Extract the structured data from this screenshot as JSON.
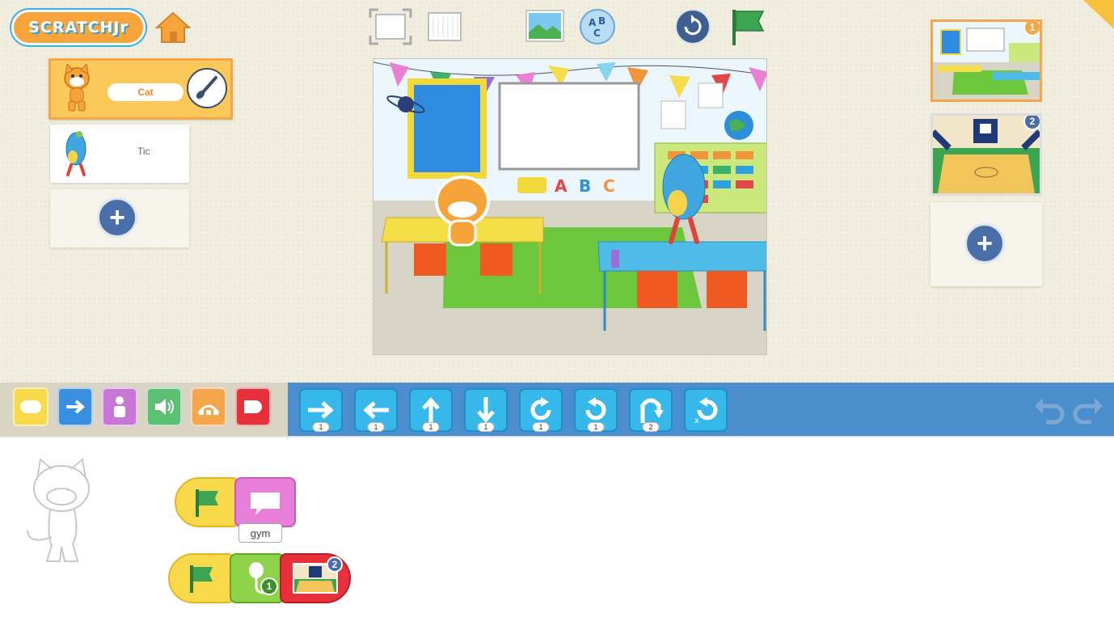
{
  "app": {
    "logo_text": "SCRATCHJr"
  },
  "sprites": [
    {
      "name": "Cat",
      "selected": true
    },
    {
      "name": "Tic",
      "selected": false
    }
  ],
  "pages": [
    {
      "number": "1",
      "selected": true
    },
    {
      "number": "2",
      "selected": false
    }
  ],
  "palette": {
    "categories": [
      "triggering",
      "motion",
      "looks",
      "sound",
      "control",
      "end"
    ],
    "blocks": [
      {
        "name": "move-right",
        "count": "1"
      },
      {
        "name": "move-left",
        "count": "1"
      },
      {
        "name": "move-up",
        "count": "1"
      },
      {
        "name": "move-down",
        "count": "1"
      },
      {
        "name": "turn-right",
        "count": "1"
      },
      {
        "name": "turn-left",
        "count": "1"
      },
      {
        "name": "hop",
        "count": "2"
      },
      {
        "name": "go-home",
        "count": ""
      }
    ]
  },
  "scripts": {
    "say_text": "gym",
    "sound_number": "1",
    "go_to_page": "2"
  },
  "colors": {
    "accent": "#4b8ecd",
    "trigger": "#f8d94a",
    "looks": "#e77fd8",
    "sound": "#8ed24a",
    "end": "#e8303a"
  }
}
